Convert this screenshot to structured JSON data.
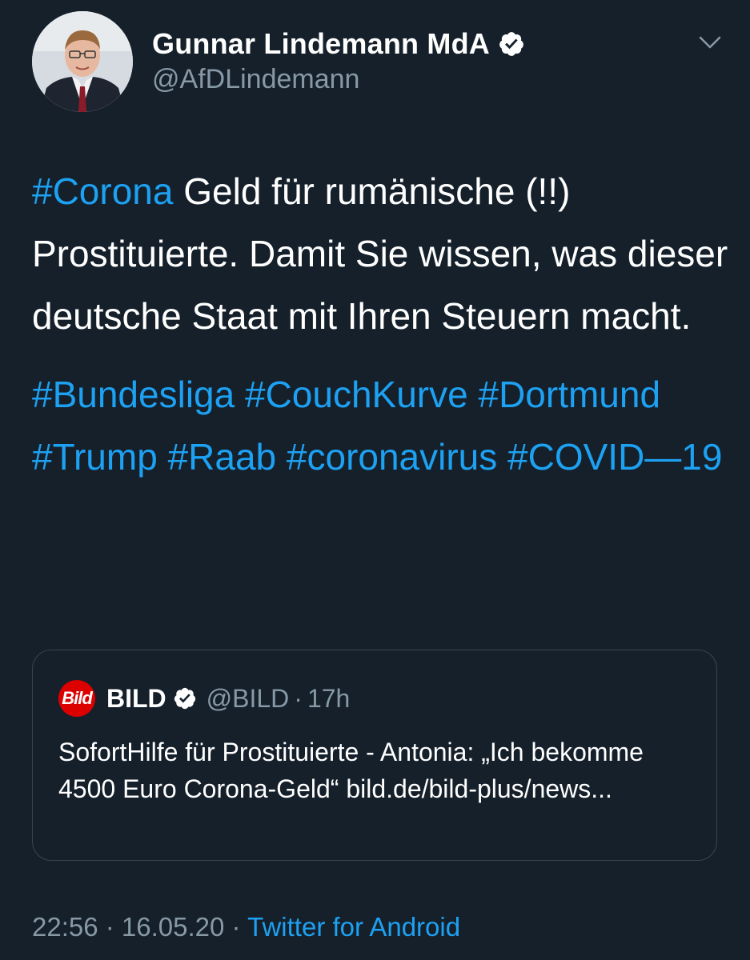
{
  "author": {
    "display_name": "Gunnar Lindemann MdA",
    "handle": "@AfDLindemann",
    "verified": true
  },
  "tweet": {
    "line1_tag": "#Corona",
    "line1_text": " Geld für rumänische (!!) Prostituierte.  Damit Sie wissen, was dieser deutsche Staat mit Ihren Steuern macht.",
    "hashtags": [
      "#Bundesliga",
      "#CouchKurve",
      "#Dortmund",
      "#Trump",
      "#Raab",
      "#coronavirus",
      "#COVID—19"
    ]
  },
  "quoted_tweet": {
    "logo_text": "Bild",
    "display_name": "BILD",
    "handle": "@BILD",
    "separator": "·",
    "time": "17h",
    "text": "SofortHilfe für Prostituierte - Antonia: „Ich bekomme 4500 Euro Corona-Geld“ bild.de/bild-plus/news..."
  },
  "footer": {
    "time": "22:56",
    "sep1": " · ",
    "date": "16.05.20",
    "sep2": " · ",
    "source": "Twitter for Android"
  },
  "colors": {
    "background": "#15202b",
    "link": "#1da1f2",
    "secondary_text": "#8899a6",
    "quote_border": "#38444d",
    "bild_red": "#dd0000"
  },
  "icons": {
    "verified": "verified-badge-icon",
    "caret": "chevron-down-icon",
    "avatar": "profile-photo"
  }
}
